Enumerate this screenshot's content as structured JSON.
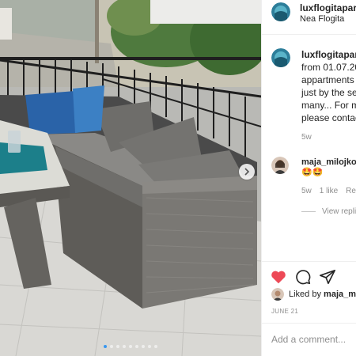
{
  "post": {
    "username": "luxflogitapartments",
    "location": "Nea Flogita",
    "caption_username": "luxflogitapartments",
    "caption_text": "from 01.07.2021 Lux Flogita appartments in Nea Flogita just by the sea and close to many... For more information please contact you...",
    "caption_emoji": "😁",
    "caption_time": "5w"
  },
  "comment": {
    "username": "maja_milojkovic",
    "emoji": "🤩🤩",
    "time": "5w",
    "likes": "1 like",
    "reply": "Reply",
    "view_replies": "View replies (1)"
  },
  "likes": {
    "prefix": "Liked by",
    "user": "maja_milojkovic"
  },
  "date": "JUNE 21",
  "add_comment": {
    "placeholder": "Add a comment..."
  },
  "carousel": {
    "slide_count": 9,
    "active_index": 0
  },
  "icons": {
    "like": "heart-icon",
    "comment": "comment-icon",
    "share": "share-icon",
    "next": "chevron-right-icon"
  },
  "colors": {
    "like_active": "#ed4956",
    "dot_active": "#3897f0",
    "meta_text": "#8e8e8e"
  }
}
